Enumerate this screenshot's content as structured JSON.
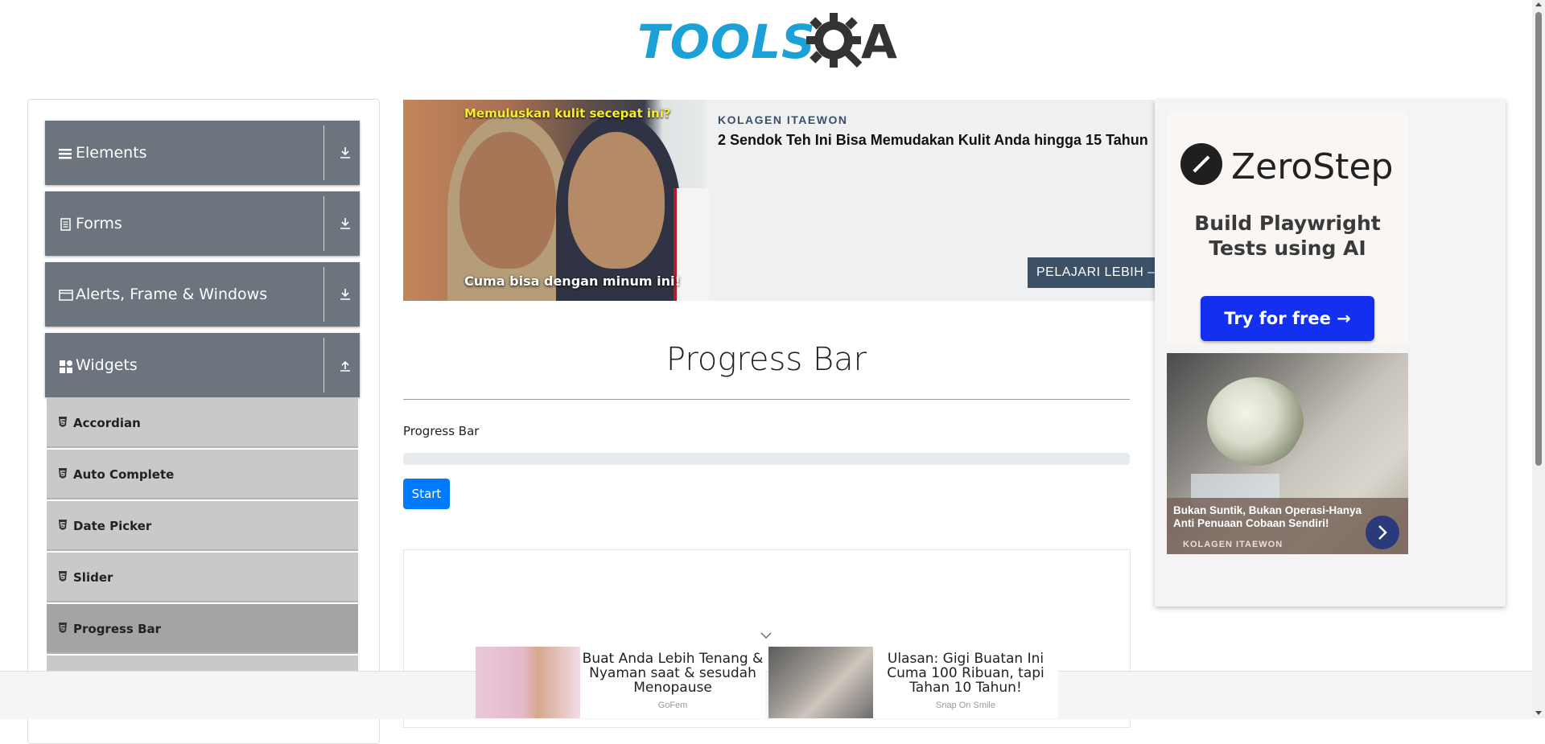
{
  "logo": {
    "text": "TOOLS",
    "q": "Q",
    "a": "A"
  },
  "sidebar": {
    "groups": [
      {
        "label": "Elements",
        "icon": "list-icon",
        "state": "collapsed"
      },
      {
        "label": "Forms",
        "icon": "document-icon",
        "state": "collapsed"
      },
      {
        "label": "Alerts, Frame & Windows",
        "icon": "window-icon",
        "state": "collapsed"
      },
      {
        "label": "Widgets",
        "icon": "widgets-icon",
        "state": "expanded"
      }
    ],
    "items": [
      {
        "label": "Accordian"
      },
      {
        "label": "Auto Complete"
      },
      {
        "label": "Date Picker"
      },
      {
        "label": "Slider"
      },
      {
        "label": "Progress Bar",
        "active": true
      }
    ]
  },
  "ad_top": {
    "image_top_text": "Memuluskan kulit secepat ini?",
    "image_bottom_text": "Cuma bisa dengan minum ini!",
    "brand": "KOLAGEN ITAEWON",
    "headline": "2 Sendok Teh Ini Bisa Memudakan Kulit Anda hingga 15 Tahun",
    "cta": "PELAJARI LEBIH –"
  },
  "main": {
    "title": "Progress Bar",
    "progress_label": "Progress Bar",
    "progress_value": 0,
    "start_button": "Start"
  },
  "ad_right": {
    "brand": "ZeroStep",
    "tagline": "Build Playwright Tests using AI",
    "cta": "Try for free →",
    "flower_text": "Bukan Suntik, Bukan Operasi-Hanya Anti Penuaan Cobaan Sendiri!",
    "flower_brand": "KOLAGEN ITAEWON"
  },
  "bottom_ads": [
    {
      "title": "Buat Anda Lebih Tenang & Nyaman saat & sesudah Menopause",
      "source": "GoFem"
    },
    {
      "title": "Ulasan: Gigi Buatan Ini Cuma 100 Ribuan, tapi Tahan 10 Tahun!",
      "source": "Snap On Smile"
    }
  ],
  "colors": {
    "accent": "#007bff",
    "sidebar_header": "#6c757d",
    "sidebar_item": "#c9c9c9",
    "sidebar_item_active": "#a4a4a4",
    "logo_blue": "#1ba1d8"
  }
}
